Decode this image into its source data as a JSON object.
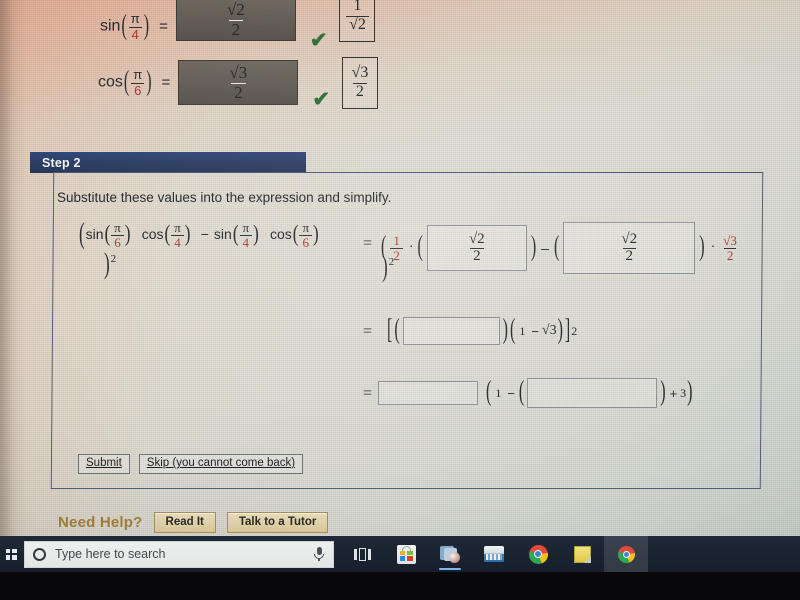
{
  "top_section": {
    "rows": [
      {
        "label_fn": "sin",
        "label_arg_num": "π",
        "label_arg_den": "4",
        "equals": "=",
        "answer_num": "√2",
        "answer_den": "2",
        "status_icon": "check-icon",
        "reference_num": "1",
        "reference_den": "√2"
      },
      {
        "label_fn": "cos",
        "label_arg_num": "π",
        "label_arg_den": "6",
        "equals": "=",
        "answer_num": "√3",
        "answer_den": "2",
        "status_icon": "check-icon",
        "reference_num": "√3",
        "reference_den": "2"
      }
    ]
  },
  "step_panel": {
    "header": "Step 2",
    "prompt": "Substitute these values into the expression and simplify.",
    "left_expression": {
      "open_paren": "(",
      "term1_fn": "sin",
      "term1_num": "π",
      "term1_den": "6",
      "term2_fn": "cos",
      "term2_num": "π",
      "term2_den": "4",
      "minus": "−",
      "term3_fn": "sin",
      "term3_num": "π",
      "term3_den": "4",
      "term4_fn": "cos",
      "term4_num": "π",
      "term4_den": "6",
      "close_paren": ")",
      "exponent": "2"
    },
    "line1": {
      "equals": "=",
      "open_paren": "(",
      "coef_num": "1",
      "coef_den": "2",
      "dot": "·",
      "inner_open": "(",
      "box1_value": "√2 / 2",
      "box1_num": "√2",
      "box1_den": "2",
      "inner_close": ")",
      "minus": "–",
      "open_paren2": "(",
      "box2_num": "√2",
      "box2_den": "2",
      "close_paren2": ")",
      "dot2": "·",
      "tail_num": "√3",
      "tail_den": "2",
      "close_paren": ")",
      "exponent": "2"
    },
    "line2": {
      "equals": "=",
      "bracket_open": "[",
      "paren_open": "(",
      "box3_value": "",
      "paren_close": ")",
      "group_open": "(",
      "one": "1",
      "minus": "−",
      "radical": "√3",
      "group_close": ")",
      "bracket_close": "]",
      "exponent": "2"
    },
    "line3": {
      "equals": "=",
      "box4_value": "",
      "group_open": "(",
      "one": "1",
      "minus": "−",
      "paren_open": "(",
      "box5_value": "",
      "paren_close": ")",
      "plus": "+",
      "three": "3",
      "group_close": ")"
    },
    "buttons": {
      "submit": "Submit",
      "skip": "Skip (you cannot come back)"
    }
  },
  "need_help": {
    "label": "Need Help?",
    "read_it": "Read It",
    "talk_to_tutor": "Talk to a Tutor"
  },
  "taskbar": {
    "start_icon": "windows-start-icon",
    "search_placeholder": "Type here to search",
    "search_icon": "search-circle-icon",
    "mic_icon": "microphone-icon",
    "task_view_icon": "task-view-icon",
    "items": [
      {
        "icon": "microsoft-store-icon",
        "label": "Microsoft Store"
      },
      {
        "icon": "bluestacks-icon",
        "label": "BlueStacks"
      },
      {
        "icon": "file-explorer-icon",
        "label": "File Explorer"
      },
      {
        "icon": "google-chrome-icon",
        "label": "Google Chrome"
      },
      {
        "icon": "notepad-icon",
        "label": "Notepad"
      },
      {
        "icon": "chrome-app-icon",
        "label": "Chrome App"
      }
    ]
  },
  "colors": {
    "step_header_bg": "#27395f",
    "panel_border": "#4e5f78",
    "check_green": "#2f6b33",
    "accent_red": "#a8342c",
    "need_help_gold": "#9e7e3c",
    "taskbar_bg": "#1a2430"
  }
}
